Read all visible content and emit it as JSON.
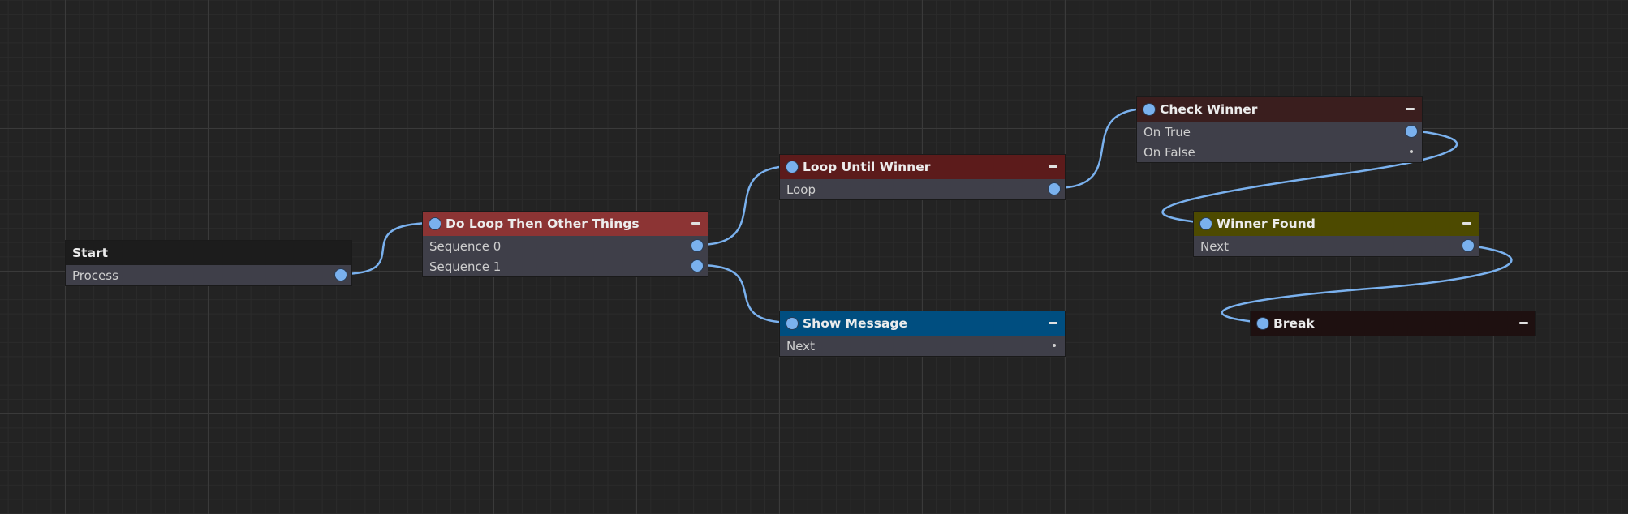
{
  "colors": {
    "background": "#232323",
    "wire": "#7ab1ee",
    "port": "#7ab1ee",
    "node_body": "#3f3f49"
  },
  "nodes": {
    "start": {
      "title": "Start",
      "color": "#1c1c1c",
      "outputs": [
        "Process"
      ]
    },
    "do_loop": {
      "title": "Do Loop Then Other Things",
      "color": "#8c3434",
      "outputs": [
        "Sequence 0",
        "Sequence 1"
      ]
    },
    "loop_until": {
      "title": "Loop Until Winner",
      "color": "#5c1b1b",
      "outputs": [
        "Loop"
      ]
    },
    "show_message": {
      "title": "Show Message",
      "color": "#004e80",
      "outputs": [
        "Next"
      ]
    },
    "check_winner": {
      "title": "Check Winner",
      "color": "#3a1e1e",
      "outputs": [
        "On True",
        "On False"
      ]
    },
    "winner_found": {
      "title": "Winner Found",
      "color": "#4d4a00",
      "outputs": [
        "Next"
      ]
    },
    "break_node": {
      "title": "Break",
      "color": "#1e1010",
      "outputs": []
    }
  },
  "icons": {
    "collapse": "minus-icon",
    "port": "circle-port-icon"
  }
}
